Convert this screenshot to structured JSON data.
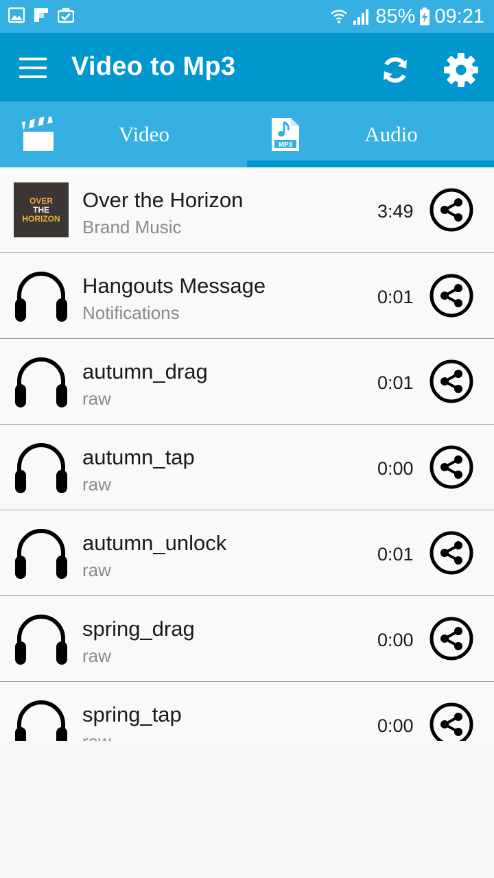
{
  "status_bar": {
    "battery": "85%",
    "time": "09:21"
  },
  "app_bar": {
    "title": "Video to Mp3"
  },
  "tabs": [
    {
      "label": "Video",
      "icon": "clapperboard-icon",
      "selected": false
    },
    {
      "label": "Audio",
      "icon": "mp3-file-icon",
      "icon_text": "MP3",
      "selected": true
    }
  ],
  "items": [
    {
      "title": "Over the Horizon",
      "subtitle": "Brand Music",
      "duration": "3:49",
      "art": "album-art",
      "art_text": [
        "OVER",
        "THE",
        "HORIZON"
      ]
    },
    {
      "title": "Hangouts Message",
      "subtitle": "Notifications",
      "duration": "0:01",
      "art": "headphones-icon"
    },
    {
      "title": "autumn_drag",
      "subtitle": "raw",
      "duration": "0:01",
      "art": "headphones-icon"
    },
    {
      "title": "autumn_tap",
      "subtitle": "raw",
      "duration": "0:00",
      "art": "headphones-icon"
    },
    {
      "title": "autumn_unlock",
      "subtitle": "raw",
      "duration": "0:01",
      "art": "headphones-icon"
    },
    {
      "title": "spring_drag",
      "subtitle": "raw",
      "duration": "0:00",
      "art": "headphones-icon"
    },
    {
      "title": "spring_tap",
      "subtitle": "raw",
      "duration": "0:00",
      "art": "headphones-icon"
    }
  ],
  "colors": {
    "status_bar": "#36b0e3",
    "app_bar": "#0097cf",
    "tab_bar": "#36b0e3",
    "indicator": "#0097cf"
  }
}
